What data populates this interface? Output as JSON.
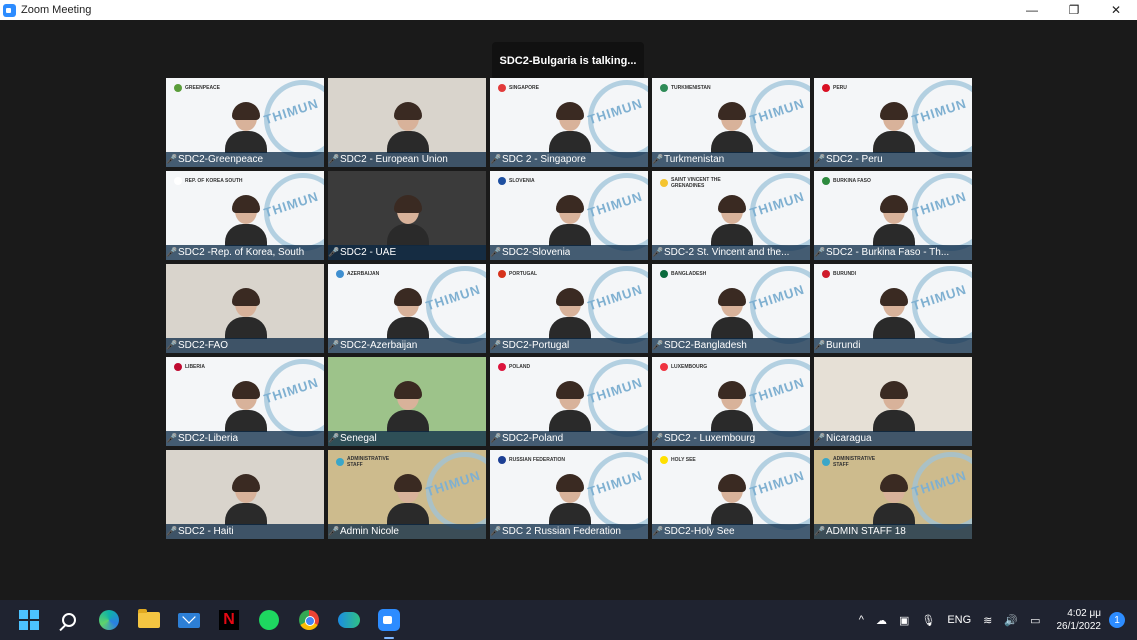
{
  "window": {
    "title": "Zoom Meeting",
    "controls": {
      "minimize": "—",
      "maximize": "❐",
      "close": "✕"
    }
  },
  "meeting": {
    "talking_indicator": "SDC2-Bulgaria is talking...",
    "participants": [
      {
        "name": "SDC2-Greenpeace",
        "country": "GREENPEACE",
        "flag": "#5a9d3a",
        "bg": "light"
      },
      {
        "name": "SDC2 - European Union",
        "country": "",
        "flag": "",
        "bg": "room"
      },
      {
        "name": "SDC 2 - Singapore",
        "country": "SINGAPORE",
        "flag": "#e23b3b",
        "bg": "light"
      },
      {
        "name": "Turkmenistan",
        "country": "TURKMENISTAN",
        "flag": "#2e8b57",
        "bg": "light"
      },
      {
        "name": "SDC2 - Peru",
        "country": "PERU",
        "flag": "#d91023",
        "bg": "light"
      },
      {
        "name": "SDC2 -Rep. of Korea, South",
        "country": "REP. OF KOREA SOUTH",
        "flag": "#ffffff",
        "bg": "light"
      },
      {
        "name": "SDC2 - UAE",
        "country": "",
        "flag": "",
        "bg": "dark"
      },
      {
        "name": "SDC2-Slovenia",
        "country": "SLOVENIA",
        "flag": "#1d4fa0",
        "bg": "light"
      },
      {
        "name": "SDC-2 St. Vincent and the...",
        "country": "SAINT VINCENT THE GRENADINES",
        "flag": "#f4c430",
        "bg": "light"
      },
      {
        "name": "SDC2 - Burkina Faso - Th...",
        "country": "BURKINA FASO",
        "flag": "#2d8a3e",
        "bg": "light"
      },
      {
        "name": "SDC2-FAO",
        "country": "",
        "flag": "",
        "bg": "room"
      },
      {
        "name": "SDC2-Azerbaijan",
        "country": "AZERBAIJAN",
        "flag": "#3f8fd0",
        "bg": "light"
      },
      {
        "name": "SDC2-Portugal",
        "country": "PORTUGAL",
        "flag": "#d6331c",
        "bg": "light"
      },
      {
        "name": "SDC2-Bangladesh",
        "country": "BANGLADESH",
        "flag": "#0a6b3d",
        "bg": "light"
      },
      {
        "name": "Burundi",
        "country": "BURUNDI",
        "flag": "#cf1b2b",
        "bg": "light"
      },
      {
        "name": "SDC2-Liberia",
        "country": "LIBERIA",
        "flag": "#bf0a30",
        "bg": "light"
      },
      {
        "name": "Senegal",
        "country": "",
        "flag": "",
        "bg": "mural"
      },
      {
        "name": "SDC2-Poland",
        "country": "POLAND",
        "flag": "#dc143c",
        "bg": "light"
      },
      {
        "name": "SDC2 - Luxembourg",
        "country": "LUXEMBOURG",
        "flag": "#ef3340",
        "bg": "light"
      },
      {
        "name": "Nicaragua",
        "country": "",
        "flag": "",
        "bg": "office"
      },
      {
        "name": "SDC2 - Haiti",
        "country": "",
        "flag": "",
        "bg": "room"
      },
      {
        "name": "Admin Nicole",
        "country": "ADMINISTRATIVE STAFF",
        "flag": "#3aa6c8",
        "bg": "gold"
      },
      {
        "name": "SDC 2 Russian Federation",
        "country": "RUSSIAN FEDERATION",
        "flag": "#1c3f94",
        "bg": "light"
      },
      {
        "name": "SDC2-Holy See",
        "country": "HOLY SEE",
        "flag": "#ffe000",
        "bg": "light"
      },
      {
        "name": "ADMIN STAFF 18",
        "country": "ADMINISTRATIVE STAFF",
        "flag": "#3aa6c8",
        "bg": "gold"
      }
    ],
    "logo_text": "THIMUN"
  },
  "taskbar": {
    "apps": [
      "start-icon",
      "search-icon",
      "edge-icon",
      "file-explorer-icon",
      "mail-icon",
      "netflix-icon",
      "spotify-icon",
      "chrome-icon",
      "webex-icon",
      "zoom-icon"
    ],
    "netflix_glyph": "N",
    "language": "ENG",
    "time": "4:02 μμ",
    "date": "26/1/2022",
    "notifications": "1",
    "tray_glyphs": {
      "chevron": "^",
      "cloud": "☁",
      "meet": "▣",
      "mic": "🎙",
      "wifi": "≋",
      "volume": "🔊",
      "battery": "▭"
    }
  }
}
